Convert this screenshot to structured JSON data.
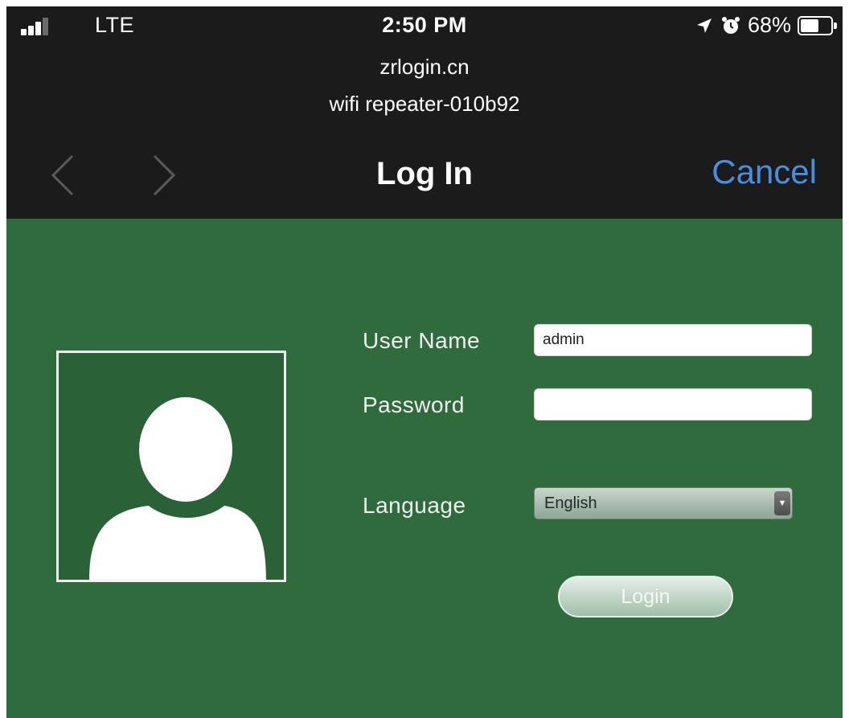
{
  "status_bar": {
    "carrier": "LTE",
    "time": "2:50 PM",
    "battery_percent": "68%",
    "battery_level": 0.68,
    "icons": [
      "cellular-signal-icon",
      "location-arrow-icon",
      "alarm-icon",
      "battery-icon"
    ]
  },
  "header": {
    "domain": "zrlogin.cn",
    "network_name": "wifi repeater-010b92",
    "title": "Log In",
    "cancel_label": "Cancel",
    "back_icon": "chevron-left-icon",
    "forward_icon": "chevron-right-icon"
  },
  "login_form": {
    "username_label": "User Name",
    "username_value": "admin",
    "password_label": "Password",
    "password_value": "",
    "language_label": "Language",
    "language_selected": "English",
    "login_label": "Login"
  },
  "colors": {
    "page_background": "#2f6b3d",
    "top_bar": "#1b1b1b",
    "cancel_link": "#4a8ee0"
  }
}
